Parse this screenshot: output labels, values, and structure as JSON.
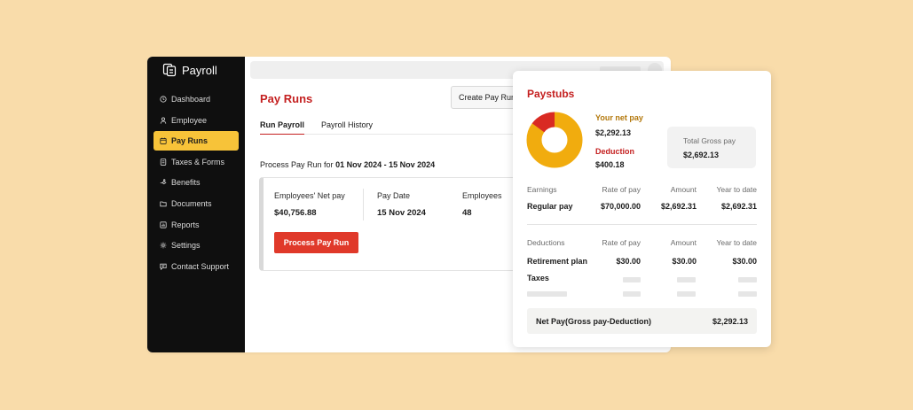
{
  "app": {
    "name": "Payroll"
  },
  "sidebar": {
    "items": [
      {
        "label": "Dashboard",
        "icon": "clock-icon"
      },
      {
        "label": "Employee",
        "icon": "person-icon"
      },
      {
        "label": "Pay Runs",
        "icon": "calendar-icon",
        "active": true
      },
      {
        "label": "Taxes & Forms",
        "icon": "file-icon"
      },
      {
        "label": "Benefits",
        "icon": "benefit-icon"
      },
      {
        "label": "Documents",
        "icon": "folder-icon"
      },
      {
        "label": "Reports",
        "icon": "chart-icon"
      },
      {
        "label": "Settings",
        "icon": "gear-icon"
      },
      {
        "label": "Contact Support",
        "icon": "message-icon"
      }
    ]
  },
  "main": {
    "title": "Pay Runs",
    "create_button": "Create Pay Run",
    "tabs": [
      {
        "label": "Run Payroll",
        "active": true
      },
      {
        "label": "Payroll History",
        "active": false
      }
    ],
    "period_prefix": "Process Pay Run for",
    "period_range": "01 Nov 2024 - 15 Nov 2024",
    "stats": [
      {
        "label": "Employees' Net pay",
        "value": "$40,756.88"
      },
      {
        "label": "Pay Date",
        "value": "15 Nov 2024"
      },
      {
        "label": "Employees",
        "value": "48"
      }
    ],
    "process_button": "Process Pay Run"
  },
  "paystub": {
    "title": "Paystubs",
    "net_label": "Your net pay",
    "net_value": "$2,292.13",
    "deduction_label": "Deduction",
    "deduction_value": "$400.18",
    "gross_label": "Total Gross pay",
    "gross_value": "$2,692.13",
    "donut": {
      "net": 2292.13,
      "deduction": 400.18,
      "net_color": "#f1ac0e",
      "deduction_color": "#d92a22"
    },
    "earnings_head": [
      "Earnings",
      "Rate of pay",
      "Amount",
      "Year to date"
    ],
    "earnings_rows": [
      [
        "Regular pay",
        "$70,000.00",
        "$2,692.31",
        "$2,692.31"
      ]
    ],
    "deductions_head": [
      "Deductions",
      "Rate of pay",
      "Amount",
      "Year to date"
    ],
    "deductions_rows": [
      [
        "Retirement plan",
        "$30.00",
        "$30.00",
        "$30.00"
      ],
      [
        "Taxes",
        "",
        "",
        ""
      ]
    ],
    "netpay_label": "Net Pay(Gross pay-Deduction)",
    "netpay_value": "$2,292.13"
  },
  "colors": {
    "accent_red": "#c41f1f",
    "button_red": "#e0392a",
    "active_nav": "#f7c339",
    "background": "#f9dcaa"
  }
}
